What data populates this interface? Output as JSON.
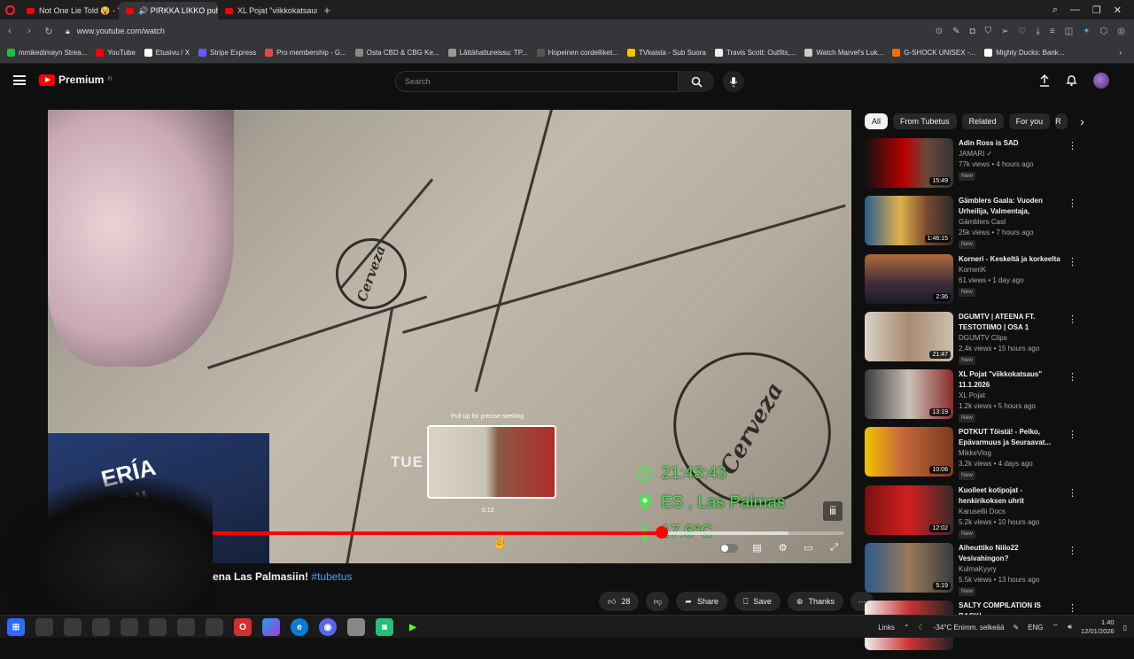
{
  "browser": {
    "tabs": [
      {
        "label": "Not One Lie Told 😵 - You",
        "active": false
      },
      {
        "label": "🔊 PIRKKA LIKKO puhutt",
        "active": true
      },
      {
        "label": "XL Pojat \"viikkokatsaus\" 1",
        "active": false
      }
    ],
    "new_tab": "+",
    "url": "www.youtube.com/watch",
    "bookmarks": [
      {
        "label": "mmikedimayn Strea...",
        "color": "#1dbf3e"
      },
      {
        "label": "YouTube",
        "color": "#ff0000"
      },
      {
        "label": "Etusivu / X",
        "color": "#ffffff"
      },
      {
        "label": "Stripe Express",
        "color": "#635bff"
      },
      {
        "label": "Pro membership - G...",
        "color": "#e24a4a"
      },
      {
        "label": "Osta CBD & CBG Ke...",
        "color": "#888888"
      },
      {
        "label": "Lättähattureissu: TP...",
        "color": "#999999"
      },
      {
        "label": "Hopeinen cordelliket...",
        "color": "#555555"
      },
      {
        "label": "TVkaista - Sub Suora",
        "color": "#f4c400"
      },
      {
        "label": "Travis Scott: Outfits,...",
        "color": "#eeeeee"
      },
      {
        "label": "Watch Marvel's Luk...",
        "color": "#cccccc"
      },
      {
        "label": "G-SHOCK UNISEX -...",
        "color": "#ff6a00"
      },
      {
        "label": "Mighty Ducks: Bank...",
        "color": "#ffffff"
      }
    ]
  },
  "youtube": {
    "logo_text": "Premium",
    "logo_sup": "FI",
    "search_placeholder": "Search",
    "video": {
      "overlay_time": "21:43:43",
      "overlay_location": "ES , Las Palmas",
      "overlay_temp": "17.6°C",
      "preview_hint": "Pull up for precise seeking",
      "preview_time": "6:12",
      "watermark": "TUE",
      "progress_fraction": 0.77,
      "buffer_fraction": 0.93,
      "hover_fraction": 0.56
    },
    "title_visible": "ena Las Palmasiin!",
    "title_hashtag": "#tubetus",
    "actions": {
      "likes": "28",
      "share": "Share",
      "save": "Save",
      "thanks": "Thanks"
    },
    "chips": [
      {
        "label": "All",
        "active": true
      },
      {
        "label": "From Tubetus",
        "active": false
      },
      {
        "label": "Related",
        "active": false
      },
      {
        "label": "For you",
        "active": false
      },
      {
        "label": "R",
        "active": false
      }
    ],
    "recommendations": [
      {
        "title": "Adin Ross is SAD",
        "channel": "JAMARI ✓",
        "stats": "77k views • 4 hours ago",
        "badge": "New",
        "duration": "15:49",
        "thumb": "linear-gradient(90deg,#111 0%,#b00 45%,#6a4a3a 70%,#333 100%)"
      },
      {
        "title": "Gämblers Gaala: Vuoden Urheilija, Valmentaja, Joukkue...",
        "channel": "Gämblers Cast",
        "stats": "25k views • 7 hours ago",
        "badge": "New",
        "duration": "1:46:15",
        "thumb": "linear-gradient(90deg,#2a5d8f,#e0b04a 40%,#7a4a30 70%,#2a2a2a)"
      },
      {
        "title": "Korneri - Keskeltä ja korkeelta",
        "channel": "KorneriK",
        "stats": "61 views • 1 day ago",
        "badge": "New",
        "duration": "2:36",
        "thumb": "linear-gradient(180deg,#b06a3a,#3e2c3a 60%,#1b1b2a)"
      },
      {
        "title": "DGUMTV | ATEENA FT. TESTOTIIMO | OSA 1",
        "channel": "DGUMTV Clips",
        "stats": "2.4k views • 15 hours ago",
        "badge": "New",
        "duration": "21:47",
        "thumb": "linear-gradient(90deg,#d8d2c6,#a88a70 50%,#c9bfae)"
      },
      {
        "title": "XL Pojat \"viikkokatsaus\" 11.1.2026",
        "channel": "XL Pojat",
        "stats": "1.2k views • 5 hours ago",
        "badge": "New",
        "duration": "13:19",
        "thumb": "linear-gradient(90deg,#3a3a3a,#c9c1b6 50%,#8a2b2b)"
      },
      {
        "title": "POTKUT Töistä! - Pelko, Epävarmuus ja Seuraavat...",
        "channel": "MikkeVlog",
        "stats": "3.2k views • 4 days ago",
        "badge": "New",
        "duration": "10:06",
        "thumb": "linear-gradient(90deg,#f4c400 0%,#c86a3a 40%,#7a3a20 100%)"
      },
      {
        "title": "Kuolleet kotipojat - henkirikoksen uhrit",
        "channel": "Karusellii Docs",
        "stats": "5.2k views • 10 hours ago",
        "badge": "New",
        "duration": "12:02",
        "thumb": "linear-gradient(90deg,#7a1010,#d02020 50%,#3a2a2a)"
      },
      {
        "title": "Aiheuttiko Niilo22 Vesivahingon?",
        "channel": "KulmaKyyry",
        "stats": "5.5k views • 13 hours ago",
        "badge": "New",
        "duration": "5:19",
        "thumb": "linear-gradient(90deg,#2c5a8a,#9a7a5a 50%,#3a3a3a)"
      },
      {
        "title": "SALTY COMPILATION IS BACK!",
        "channel": "KSI",
        "stats": "",
        "badge": "",
        "duration": "",
        "thumb": "linear-gradient(90deg,#eee,#c33 50%,#222)"
      }
    ]
  },
  "taskbar": {
    "links": "Links",
    "weather": "-34°C Enimm. selkeää",
    "lang": "ENG",
    "time": "1.40",
    "date": "12/01/2026"
  }
}
